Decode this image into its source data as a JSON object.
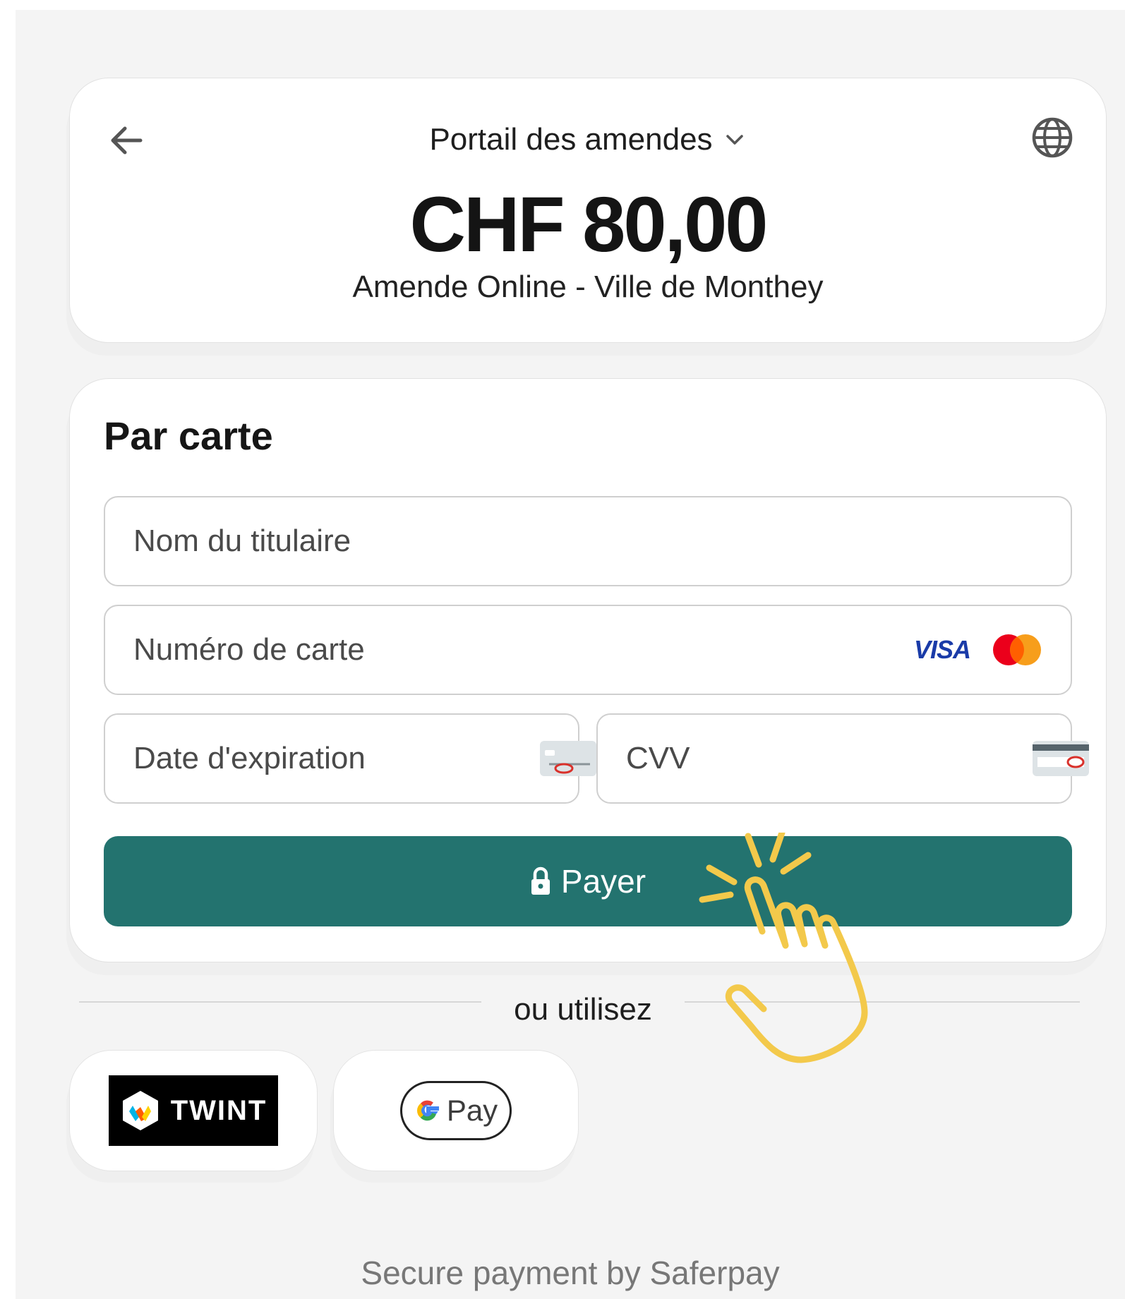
{
  "header": {
    "merchant_name": "Portail des amendes",
    "amount": "CHF 80,00",
    "description": "Amende Online - Ville de Monthey",
    "back_icon": "arrow-left-icon",
    "language_icon": "globe-icon"
  },
  "card_form": {
    "title": "Par carte",
    "holder_placeholder": "Nom du titulaire",
    "number_placeholder": "Numéro de carte",
    "expiry_placeholder": "Date d'expiration",
    "cvv_placeholder": "CVV",
    "brands": [
      "VISA",
      "Mastercard"
    ],
    "visa_label": "VISA",
    "pay_label": "Payer"
  },
  "alternatives": {
    "or_label": "ou utilisez",
    "twint_label": "TWINT",
    "gpay_label": "Pay"
  },
  "footer": {
    "text": "Secure payment by Saferpay"
  },
  "colors": {
    "accent": "#23736f",
    "background": "#f4f4f4",
    "hand_outline": "#f3c94b"
  }
}
